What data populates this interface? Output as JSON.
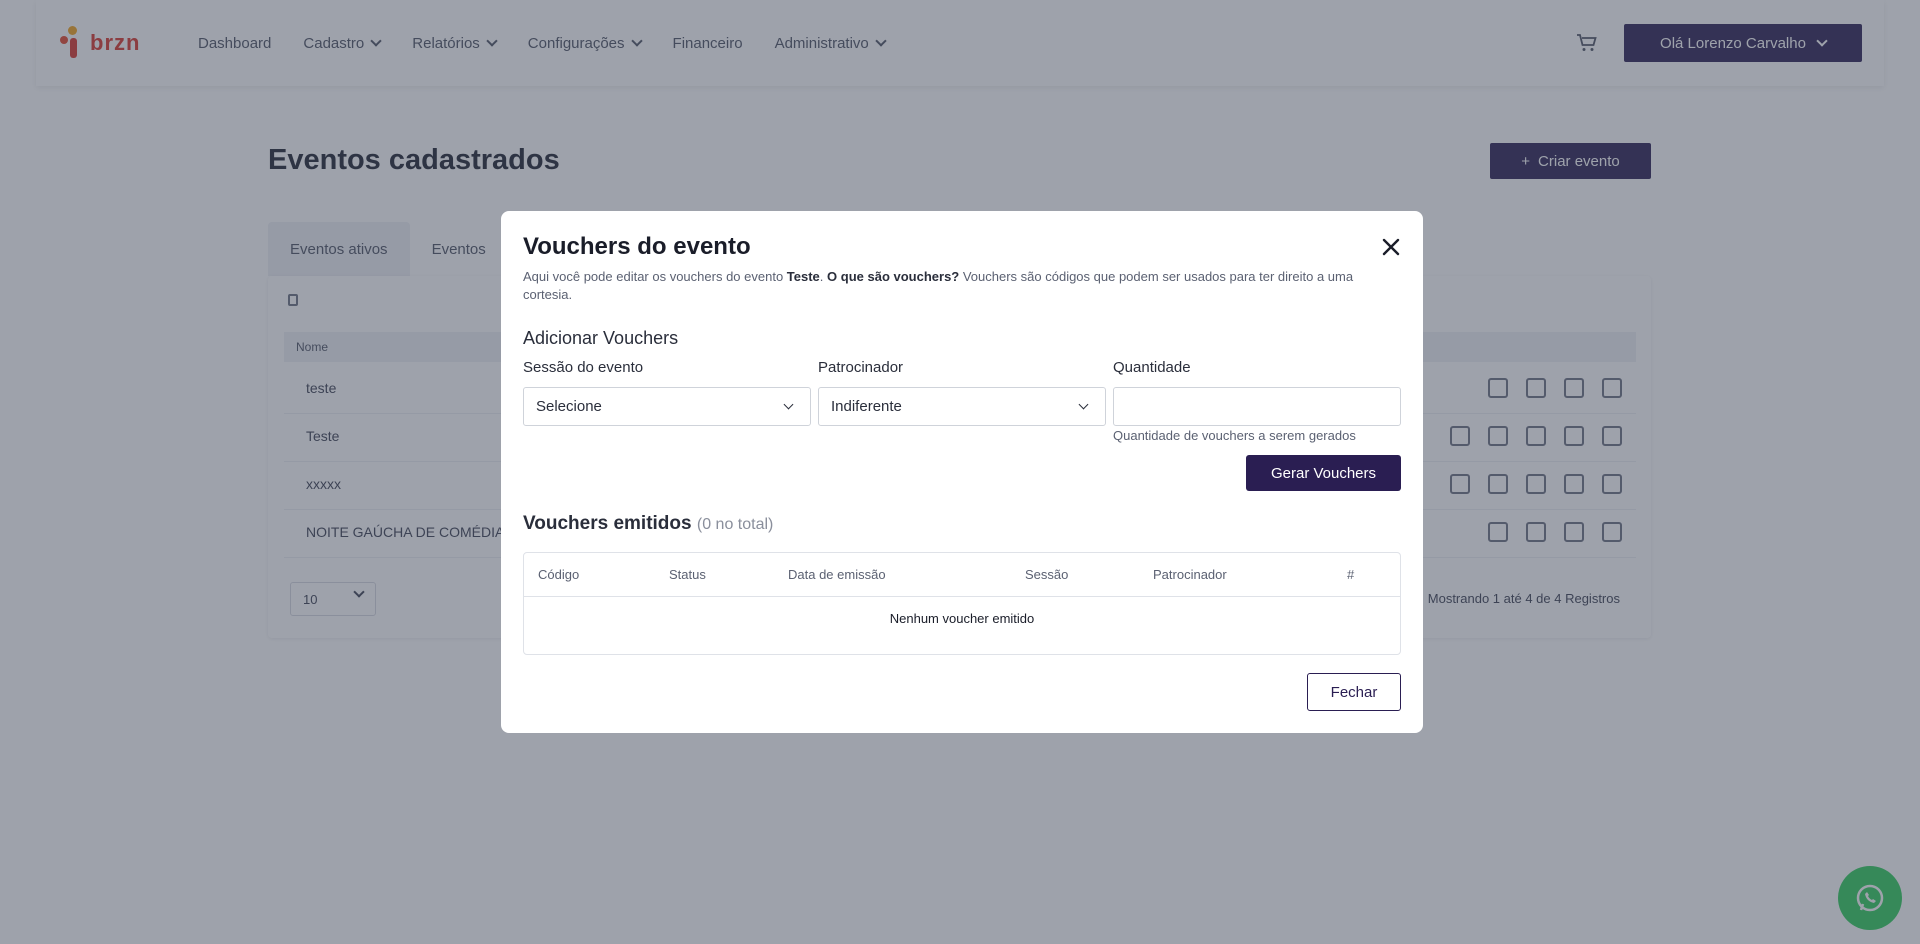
{
  "navbar": {
    "logo_text": "brzn",
    "items": [
      {
        "label": "Dashboard",
        "dropdown": false
      },
      {
        "label": "Cadastro",
        "dropdown": true
      },
      {
        "label": "Relatórios",
        "dropdown": true
      },
      {
        "label": "Configurações",
        "dropdown": true
      },
      {
        "label": "Financeiro",
        "dropdown": false
      },
      {
        "label": "Administrativo",
        "dropdown": true
      }
    ],
    "user_label": "Olá Lorenzo Carvalho"
  },
  "page": {
    "title": "Eventos cadastrados",
    "create_button": "Criar evento",
    "tabs": [
      "Eventos ativos",
      "Eventos"
    ],
    "table_header": "Nome",
    "rows": [
      "teste",
      "Teste",
      "xxxxx",
      "NOITE GAÚCHA DE COMÉDIA"
    ],
    "page_size": "10",
    "showing": "Mostrando 1 até 4 de 4 Registros"
  },
  "modal": {
    "title": "Vouchers do evento",
    "description_prefix": "Aqui você pode editar os vouchers do evento ",
    "event_name": "Teste",
    "description_mid": ". ",
    "what_are": "O que são vouchers?",
    "description_suffix": " Vouchers são códigos que podem ser usados para ter direito a uma cortesia.",
    "add_section": "Adicionar Vouchers",
    "session_label": "Sessão do evento",
    "session_value": "Selecione",
    "sponsor_label": "Patrocinador",
    "sponsor_value": "Indiferente",
    "quantity_label": "Quantidade",
    "quantity_value": "",
    "quantity_help": "Quantidade de vouchers a serem gerados",
    "generate_button": "Gerar Vouchers",
    "issued_title": "Vouchers emitidos",
    "issued_total": "(0 no total)",
    "columns": [
      "Código",
      "Status",
      "Data de emissão",
      "Sessão",
      "Patrocinador",
      "#"
    ],
    "empty_message": "Nenhum voucher emitido",
    "close_button": "Fechar"
  },
  "colors": {
    "primary": "#2a1e52",
    "overlay": "rgba(62,70,88,0.5)",
    "whatsapp": "#2ecc5a"
  }
}
